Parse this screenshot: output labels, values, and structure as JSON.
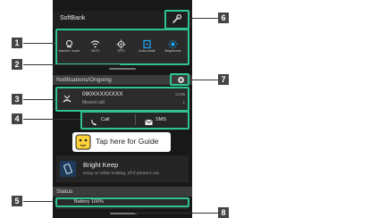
{
  "status_bar": {
    "carrier": "SoftBank"
  },
  "quick_settings": [
    {
      "label": "Manner mode",
      "icon": "manner-mode-icon"
    },
    {
      "label": "Wi-Fi",
      "icon": "wifi-icon"
    },
    {
      "label": "GPS",
      "icon": "gps-icon"
    },
    {
      "label": "Auto-rotate",
      "icon": "auto-rotate-icon"
    },
    {
      "label": "Brightness",
      "icon": "brightness-icon"
    }
  ],
  "sections": {
    "notifications": "Notifications/Ongoing",
    "status": "Status"
  },
  "notification": {
    "title": "090XXXXXXXX",
    "subtitle": "Missed call",
    "time": "13:05",
    "count": "1"
  },
  "actions": {
    "call": "Call",
    "sms": "SMS"
  },
  "guide": {
    "text": "Tap here for Guide"
  },
  "bright_keep": {
    "title": "Bright Keep",
    "description": "Keep on while holding, off if phone's out."
  },
  "status_item": "Battery 100%",
  "callouts": [
    "1",
    "2",
    "3",
    "4",
    "5",
    "6",
    "7",
    "8"
  ],
  "colors": {
    "highlight": "#2fc48f",
    "accent": "#1da1f2",
    "callout": "#444444"
  }
}
